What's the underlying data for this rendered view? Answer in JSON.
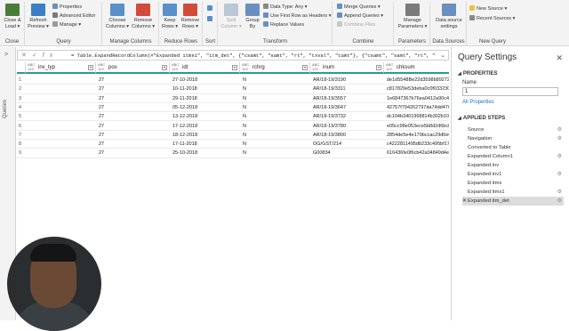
{
  "ribbon": {
    "close": {
      "label": "Close &\nLoad ▾",
      "group": "Close"
    },
    "query": {
      "refresh": "Refresh\nPreview ▾",
      "properties": "Properties",
      "advanced_editor": "Advanced Editor",
      "manage": "Manage ▾",
      "group": "Query"
    },
    "manage_columns": {
      "choose": "Choose\nColumns ▾",
      "remove": "Remove\nColumns ▾",
      "group": "Manage Columns"
    },
    "reduce_rows": {
      "keep": "Keep\nRows ▾",
      "remove": "Remove\nRows ▾",
      "group": "Reduce Rows"
    },
    "sort": {
      "group": "Sort"
    },
    "transform": {
      "split": "Split\nColumn ▾",
      "group_by": "Group\nBy",
      "data_type": "Data Type: Any ▾",
      "first_row": "Use First Row as Headers ▾",
      "replace": "Replace Values",
      "group": "Transform"
    },
    "combine": {
      "merge": "Merge Queries ▾",
      "append": "Append Queries ▾",
      "combine_files": "Combine Files",
      "group": "Combine"
    },
    "parameters": {
      "manage": "Manage\nParameters ▾",
      "group": "Parameters"
    },
    "data_sources": {
      "settings": "Data source\nsettings",
      "group": "Data Sources"
    },
    "new_query": {
      "new_source": "New Source ▾",
      "recent_sources": "Recent Sources ▾",
      "group": "New Query"
    }
  },
  "queries_pane": {
    "label": "Queries"
  },
  "formula_bar": {
    "cancel": "✕",
    "commit": "✓",
    "fx": "fx",
    "formula": "= Table.ExpandRecordColumn(#\"Expanded itms1\", \"itm_det\", {\"csamt\", \"samt\", \"rt\", \"txval\", \"camt\"}, {\"csamt\", \"samt\", \"rt\", \""
  },
  "table": {
    "columns": [
      {
        "type": "ABC\n123",
        "name": "inv_typ"
      },
      {
        "type": "ABC\n123",
        "name": "pos"
      },
      {
        "type": "ABC\n123",
        "name": "idt"
      },
      {
        "type": "ABC\n123",
        "name": "rchrg"
      },
      {
        "type": "ABC\n123",
        "name": "inum"
      },
      {
        "type": "ABC\n123",
        "name": "chksum"
      }
    ],
    "rows": [
      [
        "1",
        "",
        "27",
        "27-10-2018",
        "N",
        "AR/18-19/3190",
        "de1d5548Be22d3598b892722"
      ],
      [
        "2",
        "",
        "27",
        "10-11-2018",
        "N",
        "AR/18-19/3311",
        "c817829e53deba0c0f033230a"
      ],
      [
        "3",
        "",
        "27",
        "29-11-2018",
        "N",
        "AR/18-19/3557",
        "1e6847367b76ea0412a90c49b"
      ],
      [
        "4",
        "",
        "27",
        "05-12-2018",
        "N",
        "AR/18-19/3647",
        "42757f794262797da74dd4703"
      ],
      [
        "5",
        "",
        "27",
        "13-12-2018",
        "N",
        "AR/18-19/3732",
        "dc104b3401968814b302b107"
      ],
      [
        "6",
        "",
        "27",
        "17-12-2018",
        "N",
        "AR/18-19/3780",
        "e05cc98e053ece5b8d2d6bcff"
      ],
      [
        "7",
        "",
        "27",
        "18-12-2018",
        "N",
        "AR/18-19/3800",
        "2854de5e4e179bccac29d6e09"
      ],
      [
        "8",
        "",
        "27",
        "17-11-2018",
        "N",
        "OG/GST/214",
        "c4222811495db233c495bf175"
      ],
      [
        "9",
        "",
        "27",
        "25-10-2018",
        "N",
        "G00834",
        "616436fe0f6cb42a04849d4ec"
      ]
    ]
  },
  "settings": {
    "title": "Query Settings",
    "close": "✕",
    "properties_header": "PROPERTIES",
    "name_label": "Name",
    "name_value": "1",
    "all_properties": "All Properties",
    "applied_steps_header": "APPLIED STEPS",
    "steps": [
      {
        "label": "Source",
        "gear": "⚙"
      },
      {
        "label": "Navigation",
        "gear": "⚙"
      },
      {
        "label": "Converted to Table",
        "gear": ""
      },
      {
        "label": "Expanded Column1",
        "gear": "⚙"
      },
      {
        "label": "Expanded inv",
        "gear": ""
      },
      {
        "label": "Expanded inv1",
        "gear": "⚙"
      },
      {
        "label": "Expanded itms",
        "gear": ""
      },
      {
        "label": "Expanded itms1",
        "gear": "⚙"
      },
      {
        "label": "Expanded itm_det",
        "gear": "⚙"
      }
    ]
  },
  "colors": {
    "accent": "#2e9a8b",
    "link": "#1b6fc9",
    "selected_step": "#dcdcdc"
  }
}
